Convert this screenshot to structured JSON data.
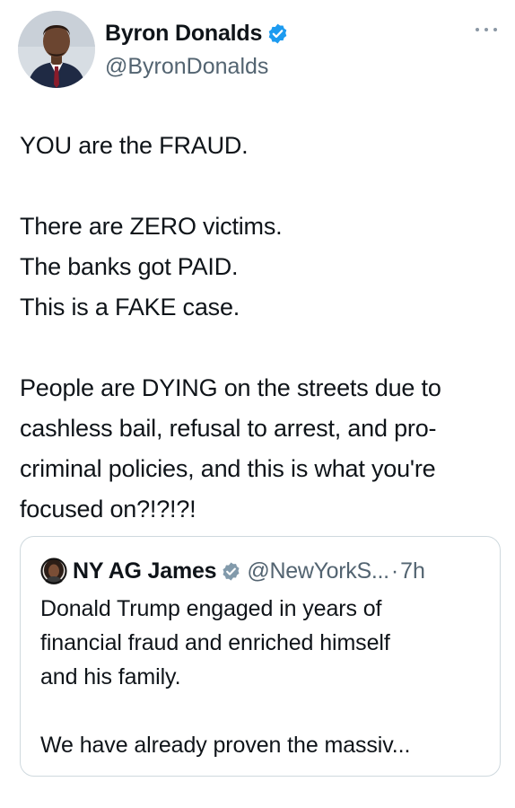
{
  "author": {
    "display_name": "Byron Donalds",
    "handle": "@ByronDonalds",
    "verified": true,
    "avatar_icon": "profile-photo-avatar",
    "more_icon": "more-options-icon"
  },
  "tweet": {
    "paragraphs": [
      [
        "YOU are the FRAUD."
      ],
      [
        "There are ZERO victims.",
        "The banks got PAID.",
        "This is a FAKE case."
      ],
      [
        "People are DYING on the streets due to",
        "cashless bail, refusal to arrest, and pro-",
        "criminal policies, and this is what you're",
        "focused on?!?!?!"
      ]
    ]
  },
  "quoted_tweet": {
    "display_name": "NY AG James",
    "handle": "@NewYorkS...",
    "separator": "·",
    "time": "7h",
    "verified_color": "#829aab",
    "paragraphs": [
      [
        "Donald Trump engaged in years of",
        "financial fraud and enriched himself",
        "and his family."
      ],
      [
        "We have already proven the massiv..."
      ]
    ]
  },
  "colors": {
    "verified_badge": "#1d9bf0",
    "secondary_text": "#536471",
    "border": "#cfd9de"
  }
}
